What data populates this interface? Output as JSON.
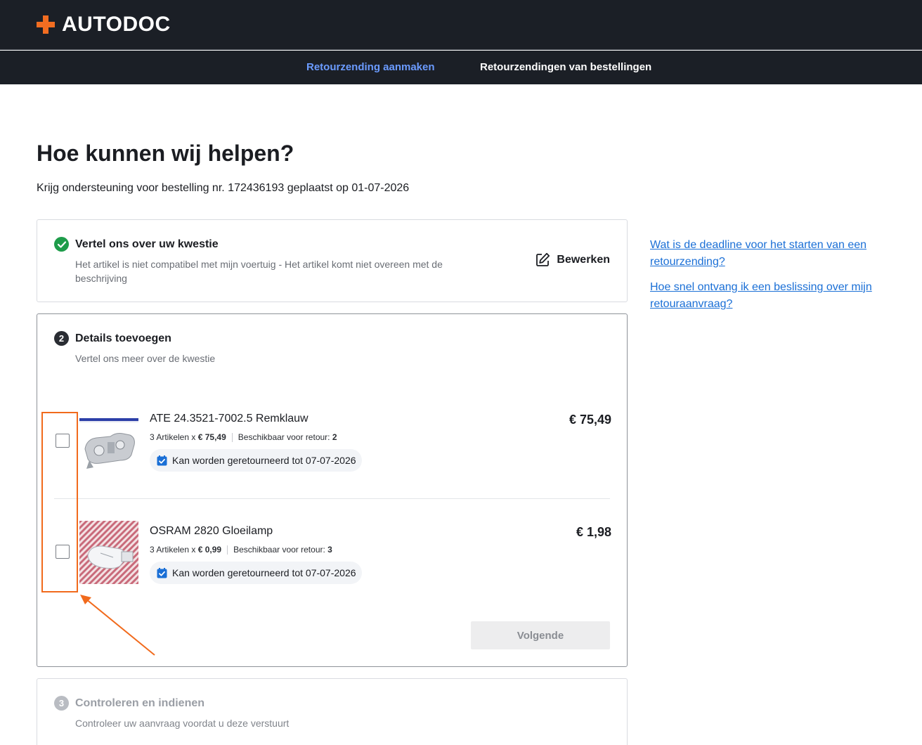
{
  "brand": {
    "name": "AUTODOC",
    "accent": "#f26d21"
  },
  "nav": {
    "tabs": [
      {
        "label": "Retourzending aanmaken",
        "active": true
      },
      {
        "label": "Retourzendingen van bestellingen",
        "active": false
      }
    ]
  },
  "page": {
    "title": "Hoe kunnen wij helpen?",
    "subtitle": "Krijg ondersteuning voor bestelling nr. 172436193 geplaatst op 01-07-2026"
  },
  "steps": [
    {
      "number": "1",
      "status": "done",
      "title": "Vertel ons over uw kwestie",
      "description": "Het artikel is niet compatibel met mijn voertuig - Het artikel komt niet overeen met de beschrijving",
      "edit_label": "Bewerken"
    },
    {
      "number": "2",
      "status": "current",
      "title": "Details toevoegen",
      "description": "Vertel ons meer over de kwestie",
      "items": [
        {
          "name": "ATE 24.3521-7002.5 Remklauw",
          "qty_label": "3 Artikelen x",
          "unit_price": "€ 75,49",
          "available_label": "Beschikbaar voor retour:",
          "available": "2",
          "price": "€ 75,49",
          "return_label": "Kan worden geretourneerd tot 07-07-2026",
          "checked": false,
          "thumb_icon": "brake-caliper-image"
        },
        {
          "name": "OSRAM 2820 Gloeilamp",
          "qty_label": "3 Artikelen x",
          "unit_price": "€ 0,99",
          "available_label": "Beschikbaar voor retour:",
          "available": "3",
          "price": "€ 1,98",
          "return_label": "Kan worden geretourneerd tot 07-07-2026",
          "checked": false,
          "thumb_icon": "bulb-image"
        }
      ],
      "next_label": "Volgende"
    },
    {
      "number": "3",
      "status": "pending",
      "title": "Controleren en indienen",
      "description": "Controleer uw aanvraag voordat u deze verstuurt"
    }
  ],
  "faq": [
    "Wat is de deadline voor het starten van een retourzending?",
    "Hoe snel ontvang ik een beslissing over mijn retouraanvraag?"
  ],
  "annotation": {
    "color": "#f16a1c"
  }
}
